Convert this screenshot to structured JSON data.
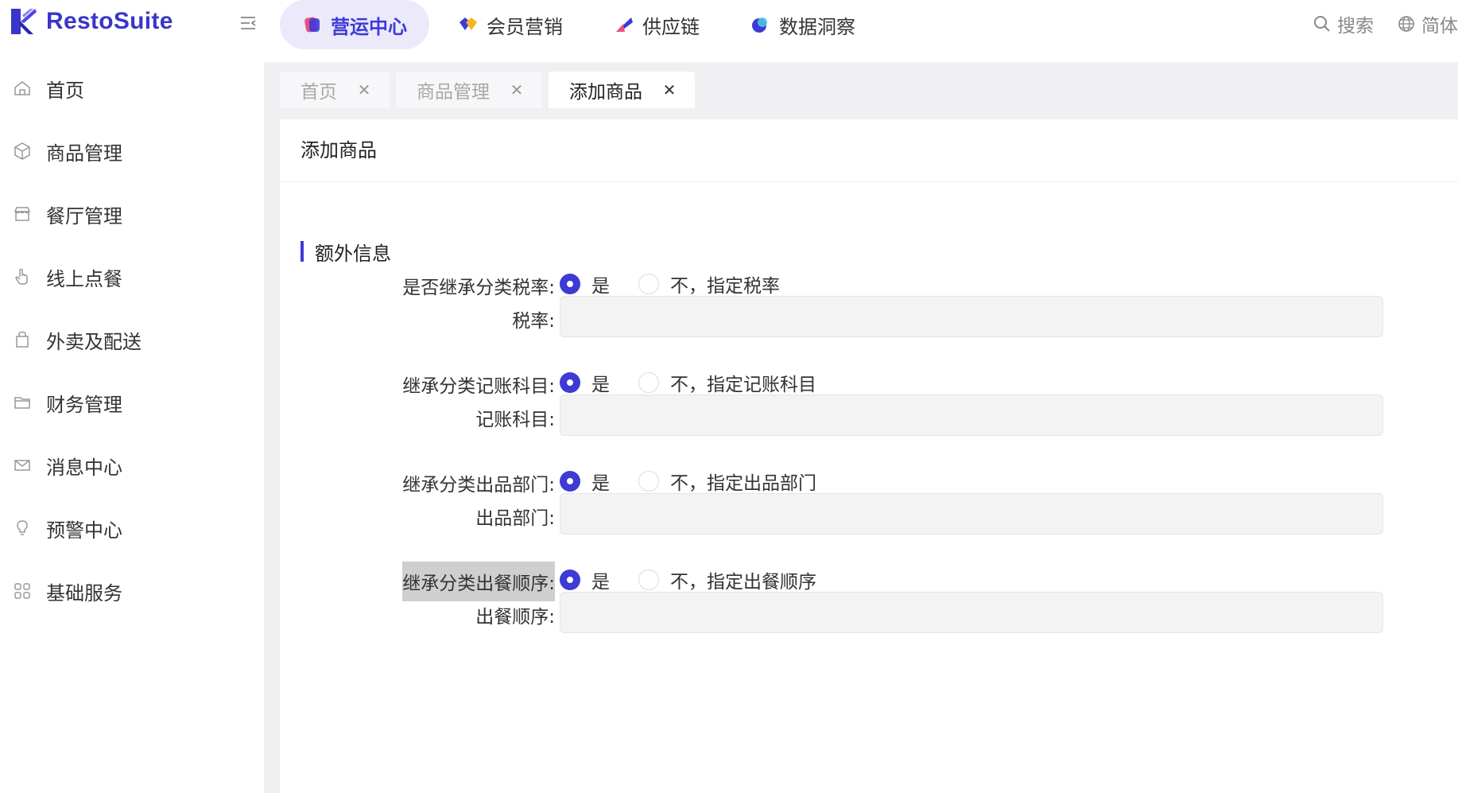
{
  "app": {
    "name": "RestoSuite"
  },
  "nav": [
    {
      "label": "营运中心",
      "active": true,
      "icon": "ops-center-icon"
    },
    {
      "label": "会员营销",
      "active": false,
      "icon": "member-marketing-icon"
    },
    {
      "label": "供应链",
      "active": false,
      "icon": "supply-chain-icon"
    },
    {
      "label": "数据洞察",
      "active": false,
      "icon": "data-insight-icon"
    }
  ],
  "topright": {
    "search_label": "搜索",
    "language_label": "简体"
  },
  "sidebar": {
    "items": [
      {
        "label": "首页",
        "icon": "home-icon"
      },
      {
        "label": "商品管理",
        "icon": "box-icon"
      },
      {
        "label": "餐厅管理",
        "icon": "store-icon"
      },
      {
        "label": "线上点餐",
        "icon": "hand-pointer-icon"
      },
      {
        "label": "外卖及配送",
        "icon": "bag-icon"
      },
      {
        "label": "财务管理",
        "icon": "folder-icon"
      },
      {
        "label": "消息中心",
        "icon": "mail-icon"
      },
      {
        "label": "预警中心",
        "icon": "bulb-icon"
      },
      {
        "label": "基础服务",
        "icon": "grid-icon"
      }
    ]
  },
  "tabs": [
    {
      "label": "首页",
      "active": false
    },
    {
      "label": "商品管理",
      "active": false
    },
    {
      "label": "添加商品",
      "active": true
    }
  ],
  "panel": {
    "title": "添加商品",
    "section_title": "额外信息",
    "fields": [
      {
        "type": "radio",
        "label": "是否继承分类税率:",
        "options": [
          "是",
          "不，指定税率"
        ],
        "selected": 0
      },
      {
        "type": "input",
        "label": "税率:",
        "value": ""
      },
      {
        "type": "radio",
        "label": "继承分类记账科目:",
        "options": [
          "是",
          "不，指定记账科目"
        ],
        "selected": 0
      },
      {
        "type": "input",
        "label": "记账科目:",
        "value": ""
      },
      {
        "type": "radio",
        "label": "继承分类出品部门:",
        "options": [
          "是",
          "不，指定出品部门"
        ],
        "selected": 0
      },
      {
        "type": "input",
        "label": "出品部门:",
        "value": ""
      },
      {
        "type": "radio",
        "label": "继承分类出餐顺序:",
        "options": [
          "是",
          "不，指定出餐顺序"
        ],
        "selected": 0
      },
      {
        "type": "input",
        "label": "出餐顺序:",
        "value": ""
      }
    ]
  },
  "colors": {
    "accent": "#3e3ad6",
    "nav_active_bg": "#ebe9fa",
    "content_bg": "#f0f0f3"
  }
}
